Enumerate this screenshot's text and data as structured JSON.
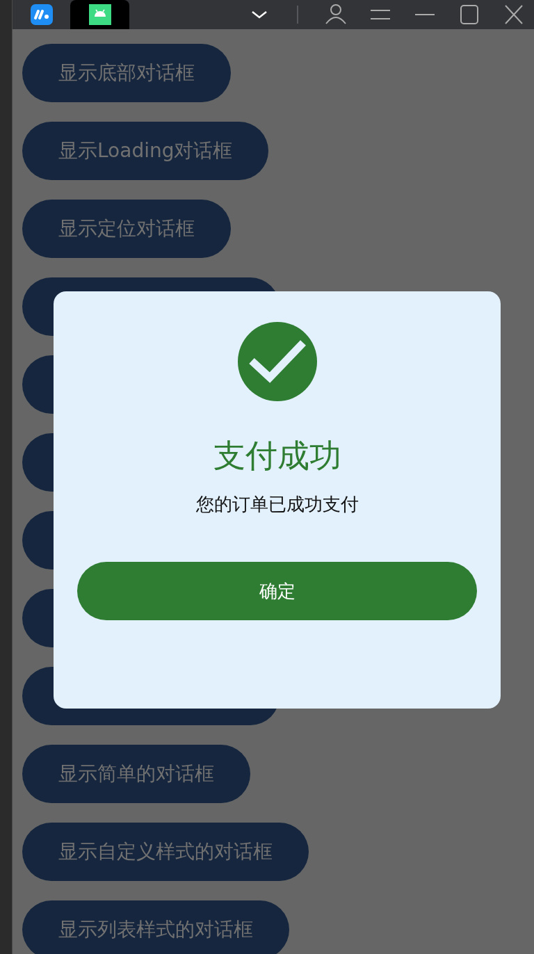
{
  "titlebar": {
    "tabs": [
      {
        "kind": "app",
        "selected": false
      },
      {
        "kind": "android",
        "selected": true
      }
    ]
  },
  "buttons": [
    {
      "kind": "labeled",
      "label": "显示底部对话框"
    },
    {
      "kind": "labeled",
      "label": "显示Loading对话框"
    },
    {
      "kind": "labeled",
      "label": "显示定位对话框"
    },
    {
      "kind": "covered"
    },
    {
      "kind": "covered"
    },
    {
      "kind": "covered"
    },
    {
      "kind": "covered"
    },
    {
      "kind": "covered"
    },
    {
      "kind": "covered"
    },
    {
      "kind": "labeled",
      "label": "显示简单的对话框"
    },
    {
      "kind": "labeled",
      "label": "显示自定义样式的对话框"
    },
    {
      "kind": "labeled",
      "label": "显示列表样式的对话框"
    }
  ],
  "dialog": {
    "title": "支付成功",
    "message": "您的订单已成功支付",
    "confirm": "确定"
  }
}
